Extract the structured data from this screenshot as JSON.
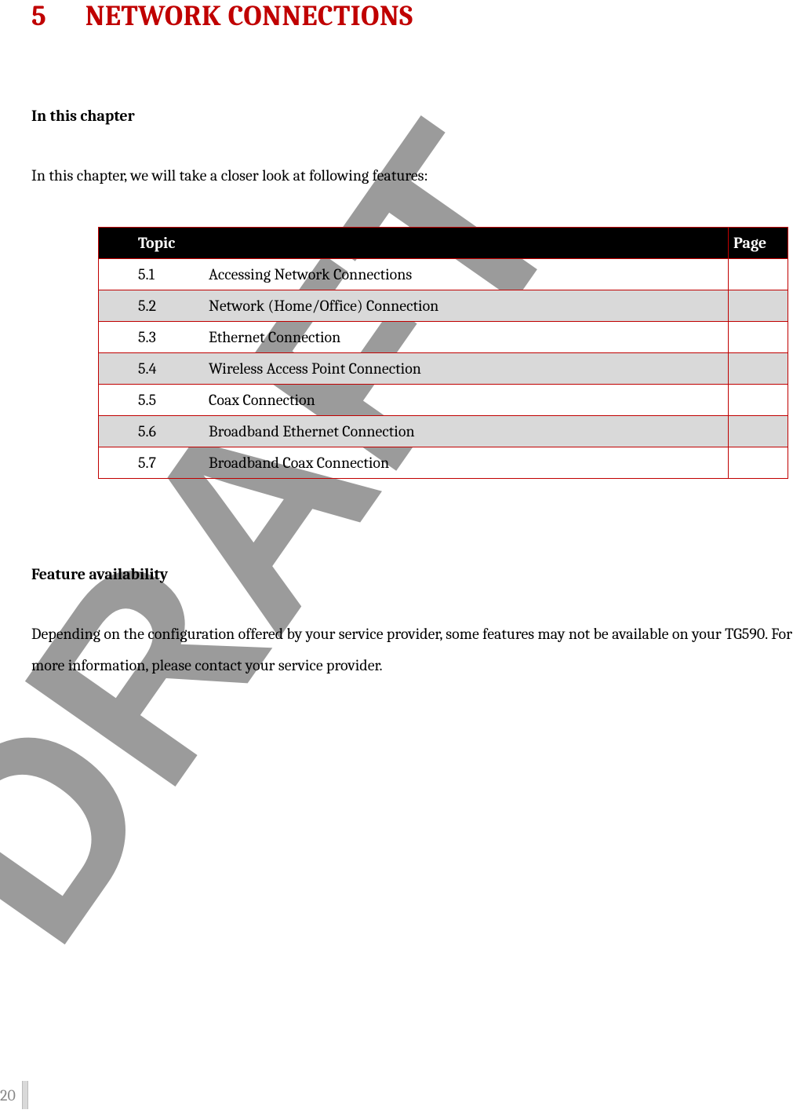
{
  "chapter": {
    "number": "5",
    "title": "NETWORK CONNECTIONS"
  },
  "section1_heading": "In this chapter",
  "section1_body": "In this chapter, we will take a closer look at following features:",
  "toc": {
    "header_topic": "Topic",
    "header_page": "Page",
    "rows": [
      {
        "num": "5.1",
        "topic": "Accessing Network Connections",
        "page": ""
      },
      {
        "num": "5.2",
        "topic": "Network (Home/Office) Connection",
        "page": ""
      },
      {
        "num": "5.3",
        "topic": "Ethernet Connection",
        "page": ""
      },
      {
        "num": "5.4",
        "topic": "Wireless Access Point Connection",
        "page": ""
      },
      {
        "num": "5.5",
        "topic": "Coax Connection",
        "page": ""
      },
      {
        "num": "5.6",
        "topic": "Broadband Ethernet Connection",
        "page": ""
      },
      {
        "num": "5.7",
        "topic": "Broadband Coax Connection",
        "page": ""
      }
    ]
  },
  "section2_heading": "Feature availability",
  "section2_body": "Depending on the configuration offered by your service provider, some features may not be available on your TG590. For more information, please contact your service provider.",
  "page_number": "20",
  "watermark_text": "DRAFT"
}
